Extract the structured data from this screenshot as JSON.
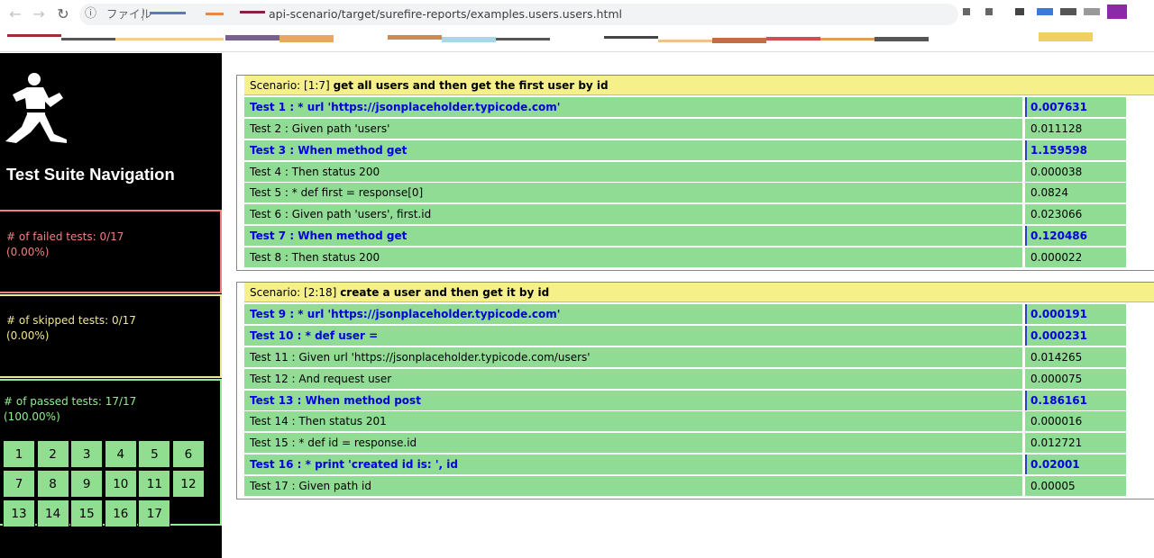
{
  "browser": {
    "omnibox_label": "ファイル",
    "url_text": "api-scenario/target/surefire-reports/examples.users.users.html"
  },
  "icons": {
    "back": "arrow-left-icon",
    "forward": "arrow-right-icon",
    "reload": "reload-icon",
    "info": "info-icon"
  },
  "colors": {
    "failed": "#f08080",
    "skipped": "#f0e68c",
    "passed": "#90ee90",
    "scenario_header": "#f5f08a",
    "step_bg": "#90dc94",
    "link": "#0000e0"
  },
  "sidebar": {
    "title": "Test Suite Navigation",
    "failed": {
      "label": "# of failed tests: 0/17",
      "percent": "(0.00%)"
    },
    "skipped": {
      "label": "# of skipped tests: 0/17",
      "percent": "(0.00%)"
    },
    "passed": {
      "label": "# of passed tests: 17/17",
      "percent": "(100.00%)"
    },
    "grid_rows": [
      [
        "1",
        "2",
        "3",
        "4",
        "5",
        "6"
      ],
      [
        "7",
        "8",
        "9",
        "10",
        "11",
        "12"
      ],
      [
        "13",
        "14",
        "15",
        "16",
        "17"
      ]
    ]
  },
  "scenarios": [
    {
      "prefix": "Scenario:",
      "id": "[1:7]",
      "name": "get all users and then get the first user by id",
      "steps": [
        {
          "name": "Test 1 : * url 'https://jsonplaceholder.typicode.com'",
          "time": "0.007631",
          "link": true
        },
        {
          "name": "Test 2 : Given path 'users'",
          "time": "0.011128",
          "link": false
        },
        {
          "name": "Test 3 : When method get",
          "time": "1.159598",
          "link": true
        },
        {
          "name": "Test 4 : Then status 200",
          "time": "0.000038",
          "link": false
        },
        {
          "name": "Test 5 : * def first = response[0]",
          "time": "0.0824",
          "link": false
        },
        {
          "name": "Test 6 : Given path 'users', first.id",
          "time": "0.023066",
          "link": false
        },
        {
          "name": "Test 7 : When method get",
          "time": "0.120486",
          "link": true
        },
        {
          "name": "Test 8 : Then status 200",
          "time": "0.000022",
          "link": false
        }
      ]
    },
    {
      "prefix": "Scenario:",
      "id": "[2:18]",
      "name": "create a user and then get it by id",
      "steps": [
        {
          "name": "Test 9 : * url 'https://jsonplaceholder.typicode.com'",
          "time": "0.000191",
          "link": true
        },
        {
          "name": "Test 10 : * def user =",
          "time": "0.000231",
          "link": true
        },
        {
          "name": "Test 11 : Given url 'https://jsonplaceholder.typicode.com/users'",
          "time": "0.014265",
          "link": false
        },
        {
          "name": "Test 12 : And request user",
          "time": "0.000075",
          "link": false
        },
        {
          "name": "Test 13 : When method post",
          "time": "0.186161",
          "link": true
        },
        {
          "name": "Test 14 : Then status 201",
          "time": "0.000016",
          "link": false
        },
        {
          "name": "Test 15 : * def id = response.id",
          "time": "0.012721",
          "link": false
        },
        {
          "name": "Test 16 : * print 'created id is: ', id",
          "time": "0.02001",
          "link": true
        },
        {
          "name": "Test 17 : Given path id",
          "time": "0.00005",
          "link": false
        }
      ]
    }
  ]
}
